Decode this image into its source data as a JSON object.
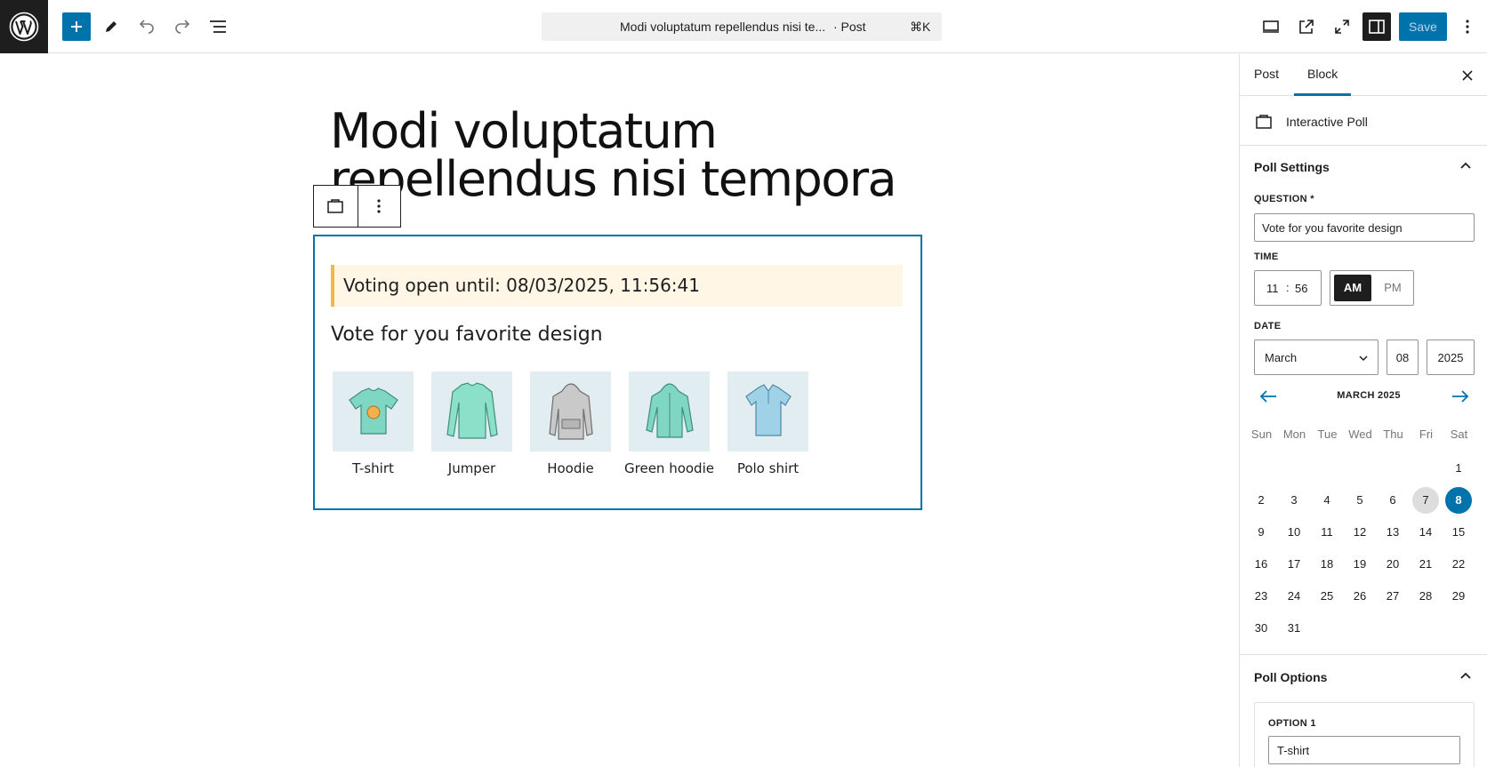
{
  "topbar": {
    "command_title": "Modi voluptatum repellendus nisi te...",
    "command_type": "· Post",
    "command_shortcut": "⌘K",
    "save_label": "Save"
  },
  "editor": {
    "post_title": "Modi voluptatum repellendus nisi tempora",
    "poll": {
      "notice": "Voting open until: 08/03/2025, 11:56:41",
      "question": "Vote for you favorite design",
      "options": [
        {
          "label": "T-shirt",
          "icon": "tshirt-image"
        },
        {
          "label": "Jumper",
          "icon": "jumper-image"
        },
        {
          "label": "Hoodie",
          "icon": "hoodie-image"
        },
        {
          "label": "Green hoodie",
          "icon": "green-hoodie-image"
        },
        {
          "label": "Polo shirt",
          "icon": "polo-shirt-image"
        }
      ]
    }
  },
  "sidebar": {
    "tabs": [
      "Post",
      "Block"
    ],
    "active_tab": "Block",
    "block_name": "Interactive Poll",
    "poll_settings": {
      "title": "Poll Settings",
      "question_label": "QUESTION *",
      "question_value": "Vote for you favorite design",
      "time_label": "TIME",
      "hour": "11",
      "minute": "56",
      "am": "AM",
      "pm": "PM",
      "date_label": "DATE",
      "month": "March",
      "day": "08",
      "year": "2025"
    },
    "calendar": {
      "heading": "MARCH 2025",
      "weekdays": [
        "Sun",
        "Mon",
        "Tue",
        "Wed",
        "Thu",
        "Fri",
        "Sat"
      ],
      "days": [
        "1",
        "2",
        "3",
        "4",
        "5",
        "6",
        "7",
        "8",
        "9",
        "10",
        "11",
        "12",
        "13",
        "14",
        "15",
        "16",
        "17",
        "18",
        "19",
        "20",
        "21",
        "22",
        "23",
        "24",
        "25",
        "26",
        "27",
        "28",
        "29",
        "30",
        "31"
      ],
      "today": "7",
      "selected": "8"
    },
    "poll_options": {
      "title": "Poll Options",
      "option1_label": "OPTION 1",
      "option1_value": "T-shirt"
    }
  },
  "colors": {
    "accent": "#0073aa",
    "notice_bg": "#fff6e5",
    "notice_border": "#f0b849"
  }
}
